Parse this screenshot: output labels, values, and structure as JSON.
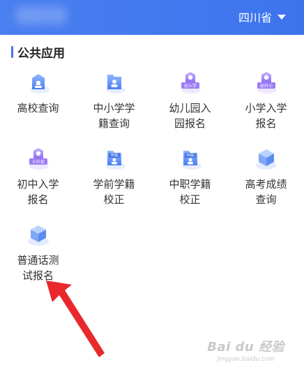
{
  "header": {
    "province": "四川省"
  },
  "section": {
    "title": "公共应用"
  },
  "apps": [
    {
      "label": "高校查询",
      "icon": "university-icon"
    },
    {
      "label": "中小学学\n籍查询",
      "icon": "student-record-icon"
    },
    {
      "label": "幼儿园入\n园报名",
      "icon": "kindergarten-badge-icon",
      "badge": "幼入学"
    },
    {
      "label": "小学入学\n报名",
      "icon": "primary-school-badge-icon",
      "badge": "幼升小"
    },
    {
      "label": "初中入学\n报名",
      "icon": "middle-school-badge-icon",
      "badge": "小升初"
    },
    {
      "label": "学前学籍\n校正",
      "icon": "preschool-record-icon",
      "badge": "学前"
    },
    {
      "label": "中职学籍\n校正",
      "icon": "vocational-record-icon",
      "badge": "中职"
    },
    {
      "label": "高考成绩\n查询",
      "icon": "cube-icon"
    },
    {
      "label": "普通话测\n试报名",
      "icon": "cube-icon"
    }
  ],
  "watermark": {
    "brand": "Bai du 经验",
    "url": "jingyan.baidu.com"
  },
  "colors": {
    "header": "#4a7ff0",
    "accent": "#4a73e8",
    "purple": "#9b7cf5",
    "text": "#333333"
  }
}
